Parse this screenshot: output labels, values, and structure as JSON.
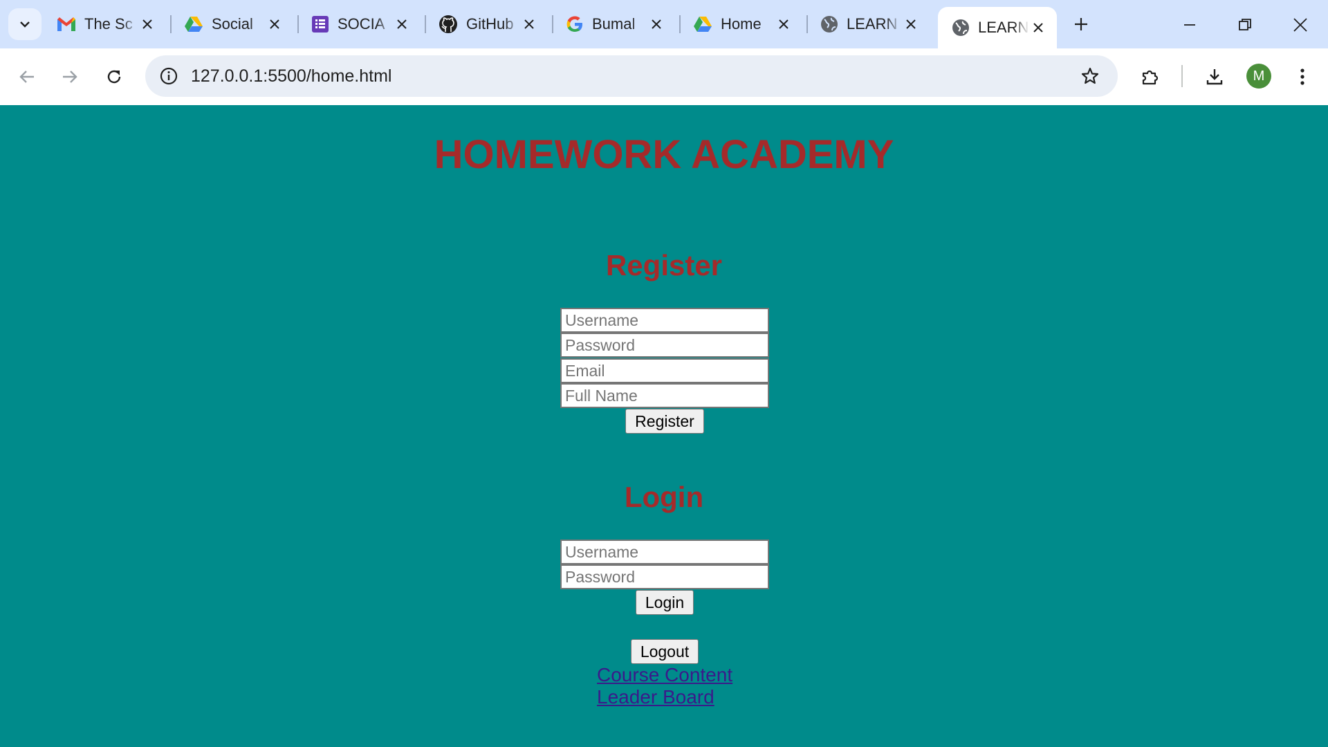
{
  "browser": {
    "tabs": [
      {
        "label": "The Sc",
        "icon": "gmail-icon"
      },
      {
        "label": "Social",
        "icon": "google-drive-icon"
      },
      {
        "label": "SOCIA",
        "icon": "google-forms-icon"
      },
      {
        "label": "GitHub",
        "icon": "github-icon"
      },
      {
        "label": "Bumal",
        "icon": "google-icon"
      },
      {
        "label": "Home",
        "icon": "google-drive-icon"
      },
      {
        "label": "LEARN",
        "icon": "globe-icon"
      },
      {
        "label": "LEARN",
        "icon": "globe-icon",
        "active": true
      }
    ],
    "url": "127.0.0.1:5500/home.html",
    "avatar_letter": "M",
    "avatar_color": "#4a8f3a",
    "tabstrip_color": "#d3e3fd"
  },
  "page": {
    "background": "#008b8b",
    "accent": "#a52a2a",
    "title": "HOMEWORK ACADEMY",
    "register": {
      "heading": "Register",
      "username_placeholder": "Username",
      "password_placeholder": "Password",
      "email_placeholder": "Email",
      "fullname_placeholder": "Full Name",
      "button": "Register"
    },
    "login": {
      "heading": "Login",
      "username_placeholder": "Username",
      "password_placeholder": "Password",
      "button": "Login"
    },
    "logout_button": "Logout",
    "links": {
      "course_content": "Course Content",
      "leader_board": "Leader Board"
    }
  }
}
